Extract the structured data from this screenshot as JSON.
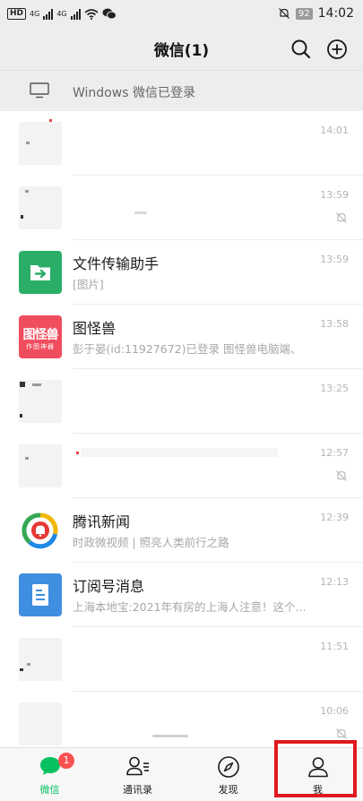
{
  "status_bar": {
    "network_a": "4G",
    "network_b": "4G",
    "hd": "HD",
    "battery": "92",
    "time": "14:02"
  },
  "header": {
    "title": "微信(1)"
  },
  "windows_bar": {
    "text": "Windows 微信已登录"
  },
  "chats": [
    {
      "name": "",
      "preview": "",
      "time": "14:01",
      "muted": false
    },
    {
      "name": "",
      "preview": "",
      "time": "13:59",
      "muted": true
    },
    {
      "name": "文件传输助手",
      "preview": "[图片]",
      "time": "13:59",
      "muted": false,
      "avatar": "file-transfer-icon",
      "avatar_color": "#2aae67"
    },
    {
      "name": "图怪兽",
      "preview": "彭于晏(id:11927672)已登录  图怪兽电脑端、",
      "time": "13:58",
      "muted": false,
      "avatar_text": "图怪兽",
      "avatar_sub": "作图神器",
      "avatar_color": "#f04d5e"
    },
    {
      "name": "",
      "preview": "",
      "time": "13:25",
      "muted": false
    },
    {
      "name": "",
      "preview": "",
      "time": "12:57",
      "muted": true
    },
    {
      "name": "腾讯新闻",
      "preview": "时政微视频 | 照亮人类前行之路",
      "time": "12:39",
      "muted": false,
      "avatar": "tencent-news-icon"
    },
    {
      "name": "订阅号消息",
      "preview": "上海本地宝:2021年有房的上海人注意！这个...",
      "time": "12:13",
      "muted": false,
      "avatar": "subscription-icon",
      "avatar_color": "#3f8ee0"
    },
    {
      "name": "",
      "preview": "",
      "time": "11:51",
      "muted": false
    },
    {
      "name": "",
      "preview": "",
      "time": "10:06",
      "muted": true
    }
  ],
  "tabs": [
    {
      "label": "微信",
      "badge": "1",
      "icon": "chat-icon",
      "active": true
    },
    {
      "label": "通讯录",
      "icon": "contacts-icon",
      "active": false
    },
    {
      "label": "发现",
      "icon": "discover-icon",
      "active": false
    },
    {
      "label": "我",
      "icon": "me-icon",
      "active": false
    }
  ],
  "colors": {
    "accent": "#07c160",
    "badge": "#fa5151",
    "highlight_box": "#e0191e"
  }
}
